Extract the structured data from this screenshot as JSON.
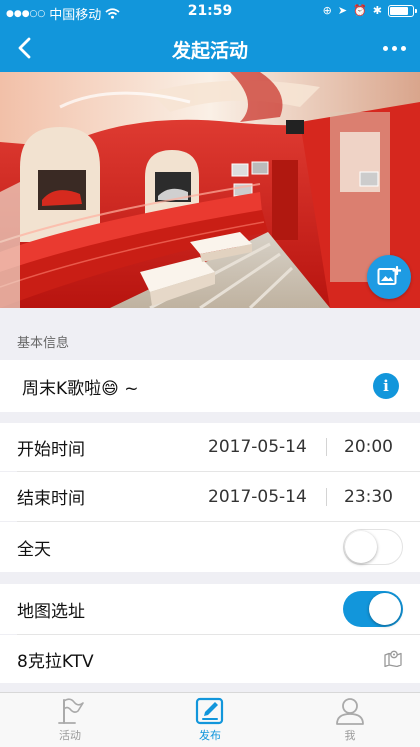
{
  "status_bar": {
    "carrier": "中国移动",
    "time": "21:59",
    "battery_level": 0.85
  },
  "nav": {
    "title": "发起活动",
    "back_icon": "chevron-left-icon",
    "more_icon": "more-horizontal-icon"
  },
  "cover": {
    "photo_button_icon": "add-photo-icon"
  },
  "basic_info": {
    "section_label": "基本信息",
    "activity_name": "周末K歌啦😄 ~",
    "info_icon": "i"
  },
  "time": {
    "start_label": "开始时间",
    "start_date": "2017-05-14",
    "start_time": "20:00",
    "end_label": "结束时间",
    "end_date": "2017-05-14",
    "end_time": "23:30",
    "allday_label": "全天",
    "allday_on": false
  },
  "location": {
    "map_label": "地图选址",
    "map_on": true,
    "place_name": "8克拉KTV",
    "map_icon": "map-pin-icon"
  },
  "tabbar": {
    "items": [
      {
        "label": "活动",
        "icon": "flag-icon",
        "active": false
      },
      {
        "label": "发布",
        "icon": "edit-icon",
        "active": true
      },
      {
        "label": "我",
        "icon": "user-icon",
        "active": false
      }
    ]
  },
  "colors": {
    "brand": "#1296db",
    "background": "#efeff4"
  }
}
